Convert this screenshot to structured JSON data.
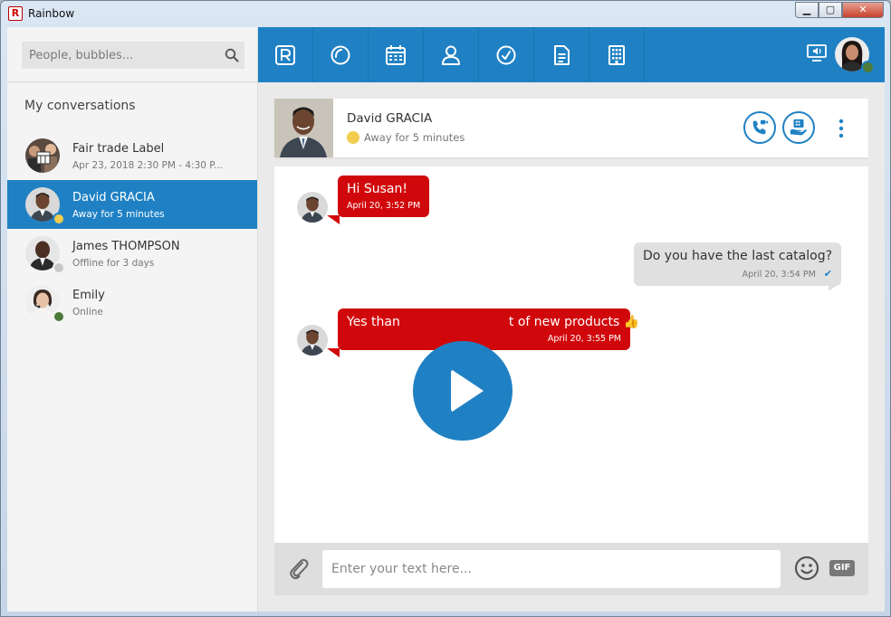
{
  "window": {
    "title": "Rainbow",
    "app_icon_letter": "R",
    "controls": {
      "minimize": "▁",
      "maximize": "▢",
      "close": "✕"
    }
  },
  "sidebar": {
    "search_placeholder": "People, bubbles...",
    "section_title": "My conversations",
    "conversations": [
      {
        "name": "Fair trade Label",
        "subtitle": "Apr 23, 2018 2:30 PM - 4:30 P...",
        "presence": "none",
        "active": false
      },
      {
        "name": "David GRACIA",
        "subtitle": "Away for 5 minutes",
        "presence": "away",
        "active": true
      },
      {
        "name": "James THOMPSON",
        "subtitle": "Offline for 3 days",
        "presence": "offline",
        "active": false
      },
      {
        "name": "Emily",
        "subtitle": "Online",
        "presence": "online",
        "active": false
      }
    ]
  },
  "navbar": {
    "icons": [
      "rainbow-logo-icon",
      "recent-circle-icon",
      "calendar-icon",
      "contacts-person-icon",
      "clock-icon",
      "document-icon",
      "building-icon"
    ],
    "right_icons": [
      "screen-share-icon",
      "user-avatar"
    ]
  },
  "contact": {
    "name": "David GRACIA",
    "status": "Away for 5 minutes"
  },
  "messages": [
    {
      "direction": "in",
      "text": "Hi Susan!",
      "time": "April 20, 3:52 PM"
    },
    {
      "direction": "out",
      "text": "Do you have the last catalog?",
      "time": "April 20, 3:54 PM"
    },
    {
      "direction": "in",
      "text": "Yes than",
      "text_tail": "t of new products",
      "time": "April 20, 3:55 PM"
    }
  ],
  "composer": {
    "placeholder": "Enter your text here...",
    "gif_label": "GIF"
  },
  "colors": {
    "brand_blue": "#1f81c4",
    "incoming_bubble": "#d1080b",
    "outgoing_bubble": "#e0e0e0",
    "away": "#f2cd4e",
    "online": "#4b7a3b",
    "offline": "#c8c8c8"
  }
}
